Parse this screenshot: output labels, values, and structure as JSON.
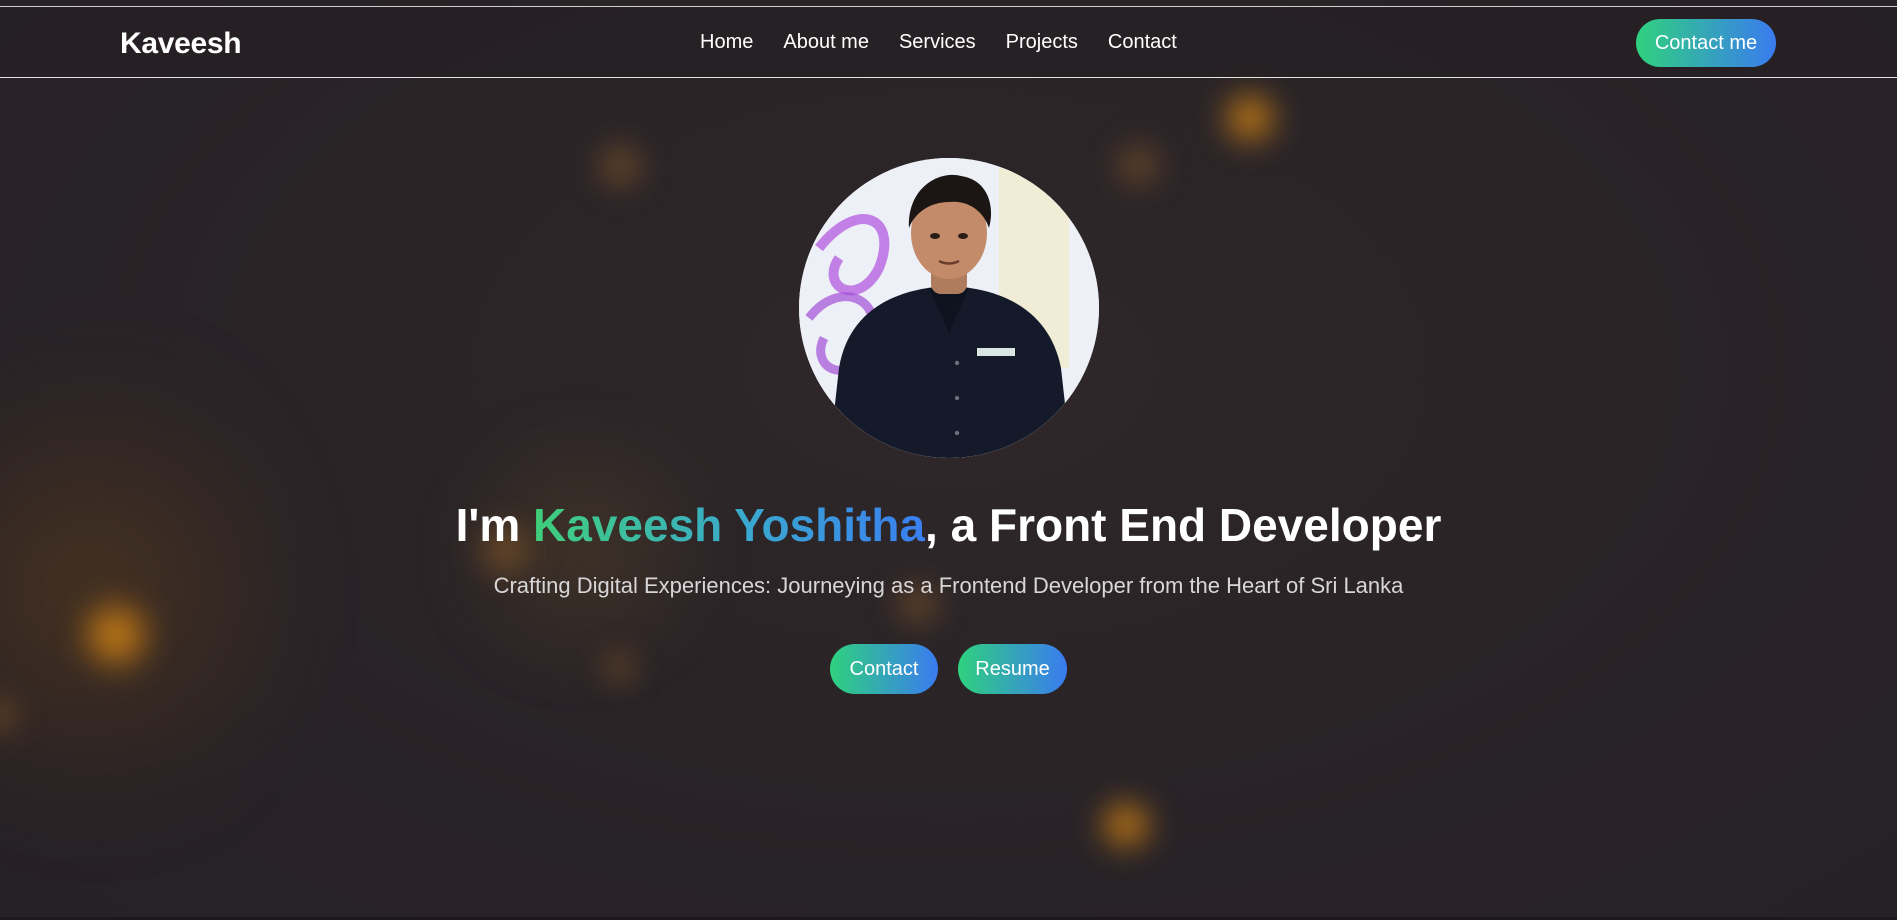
{
  "navbar": {
    "brand": "Kaveesh",
    "links": [
      "Home",
      "About me",
      "Services",
      "Projects",
      "Contact"
    ],
    "cta_label": "Contact me"
  },
  "hero": {
    "headline_prefix": "I'm ",
    "headline_name": "Kaveesh Yoshitha",
    "headline_suffix": ", a Front End Developer",
    "subtitle": "Crafting Digital Experiences: Journeying as a Frontend Developer from the Heart of Sri Lanka",
    "buttons": {
      "contact_label": "Contact",
      "resume_label": "Resume"
    }
  },
  "colors": {
    "background": "#29232a",
    "gradient_start": "#2fd17e",
    "gradient_end": "#3a7bf0",
    "text": "#ffffff",
    "subtitle_text": "#d9d6d8",
    "bokeh": "#e8961a"
  }
}
